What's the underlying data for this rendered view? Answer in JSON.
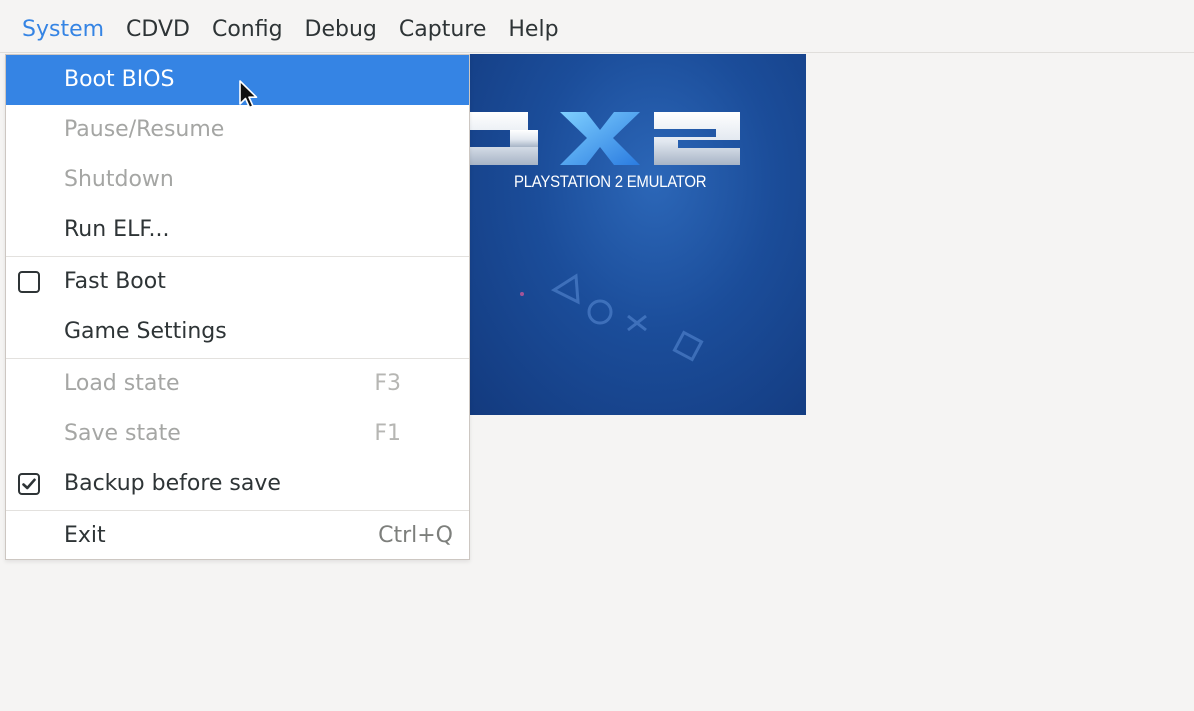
{
  "menubar": {
    "items": [
      "System",
      "CDVD",
      "Config",
      "Debug",
      "Capture",
      "Help"
    ],
    "active": "System"
  },
  "splash": {
    "logo_text": "SX2",
    "caption": "PLAYSTATION 2 EMULATOR"
  },
  "system_menu": {
    "items": [
      {
        "label": "Boot BIOS",
        "state": "highlighted"
      },
      {
        "label": "Pause/Resume",
        "state": "disabled"
      },
      {
        "label": "Shutdown",
        "state": "disabled"
      },
      {
        "label": "Run ELF...",
        "state": "enabled"
      },
      {
        "label": "Fast Boot",
        "state": "enabled",
        "checked": false
      },
      {
        "label": "Game Settings",
        "state": "enabled"
      },
      {
        "label": "Load state",
        "state": "disabled",
        "shortcut": "F3"
      },
      {
        "label": "Save state",
        "state": "disabled",
        "shortcut": "F1"
      },
      {
        "label": "Backup before save",
        "state": "enabled",
        "checked": true
      },
      {
        "label": "Exit",
        "state": "enabled",
        "shortcut": "Ctrl+Q"
      }
    ]
  },
  "colors": {
    "accent": "#3584e4",
    "disabled_text": "#a5a6a4",
    "splash_blue": "#1b4d9a"
  },
  "icons": [
    "checkbox-unchecked-icon",
    "checkbox-checked-icon",
    "mouse-pointer-icon"
  ]
}
